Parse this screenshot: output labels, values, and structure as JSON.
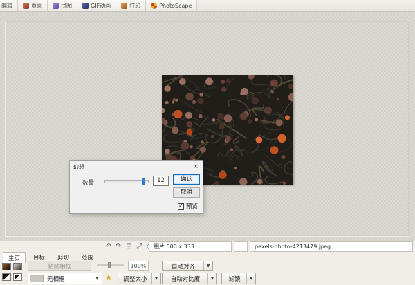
{
  "top_tabs": {
    "editor_label": "编辑",
    "items": [
      {
        "label": "页面",
        "icon": "page-icon"
      },
      {
        "label": "拼图",
        "icon": "combine-icon"
      },
      {
        "label": "GIF动画",
        "icon": "gif-icon"
      },
      {
        "label": "打印",
        "icon": "print-icon"
      },
      {
        "label": "PhotoScape",
        "icon": "photoscape-icon"
      }
    ]
  },
  "dialog": {
    "title": "幻想",
    "close": "×",
    "amount_label": "数量",
    "amount_value": "12",
    "confirm_label": "确认",
    "cancel_label": "取消",
    "preview_label": "预览",
    "checkbox_checked": "✓"
  },
  "status": {
    "icons": {
      "undo": "↶",
      "redo": "↷",
      "compare": "⊞",
      "actual_size": "⤢",
      "zoom": "◔"
    },
    "photo_info": "相片 500 x 333",
    "filename": "pexels-photo-4213479.jpeg"
  },
  "bottom": {
    "tabs": [
      {
        "label": "主页"
      },
      {
        "label": "目标"
      },
      {
        "label": "剪切"
      },
      {
        "label": "范围"
      }
    ],
    "paste_frame_label": "粘贴相框",
    "opacity_value": "100%",
    "frame_select_value": "无相框",
    "resize_label": "调整大小",
    "auto_align_label": "自动对齐",
    "auto_contrast_label": "自动对比度",
    "filter_label": "滤镜",
    "dropdown_arrow": "▼"
  },
  "photo": {
    "base_color": "#211e1a",
    "rope_colors": [
      "#3c392c",
      "#2d2f26",
      "#4a4434",
      "#565038",
      "#33302a",
      "#1f221c"
    ],
    "buoy_colors": [
      "#7d564c",
      "#8a5f52",
      "#6b463e",
      "#93685a",
      "#5c3c34",
      "#4a302a",
      "#a07264"
    ],
    "accent_buoy_colors": [
      "#c1521f",
      "#cf6428",
      "#b44718",
      "#d9693a"
    ]
  }
}
